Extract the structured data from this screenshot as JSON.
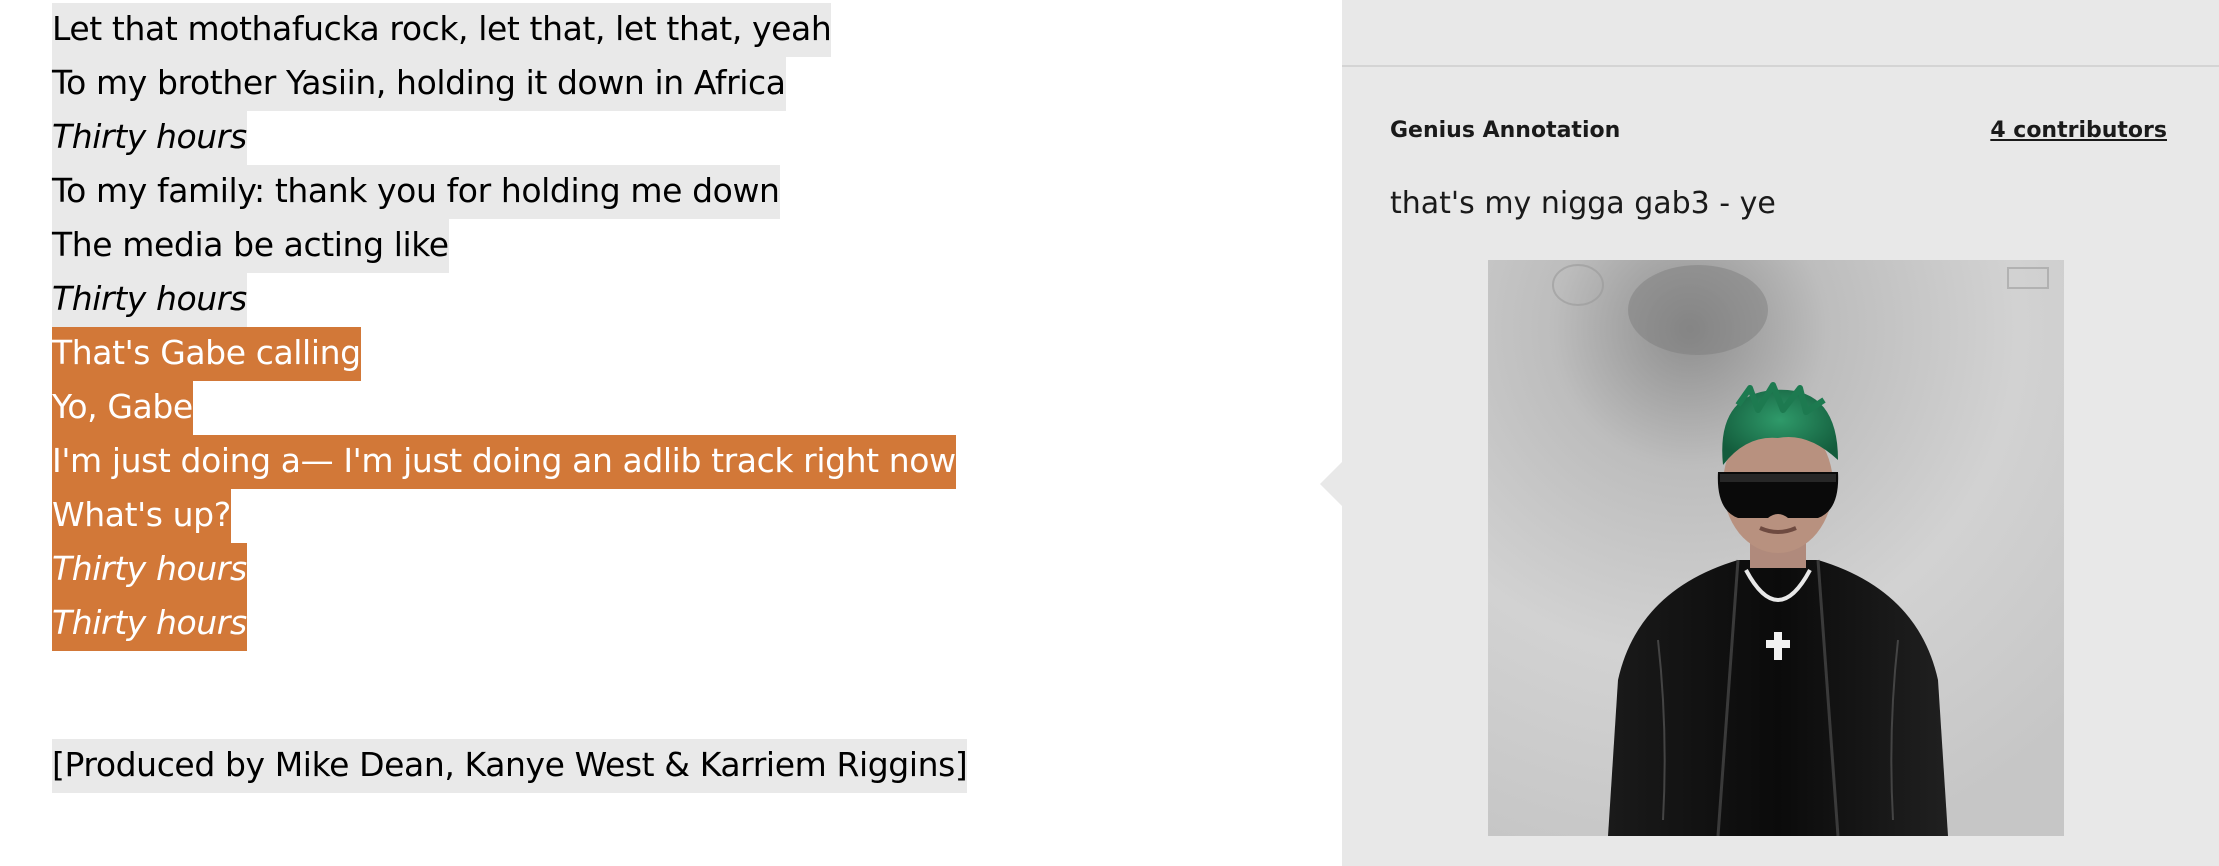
{
  "lyrics": {
    "lines": [
      {
        "text": "Let that mothafucka rock, let that, let that, yeah",
        "italic": false,
        "active": false
      },
      {
        "text": "To my brother Yasiin, holding it down in Africa",
        "italic": false,
        "active": false
      },
      {
        "text": "Thirty hours",
        "italic": true,
        "active": false
      },
      {
        "text": "To my family: thank you for holding me down",
        "italic": false,
        "active": false
      },
      {
        "text": "The media be acting like",
        "italic": false,
        "active": false
      },
      {
        "text": "Thirty hours",
        "italic": true,
        "active": false
      },
      {
        "text": "That's Gabe calling",
        "italic": false,
        "active": true
      },
      {
        "text": "Yo, Gabe",
        "italic": false,
        "active": true
      },
      {
        "text": "I'm just doing a— I'm just doing an adlib track right now",
        "italic": false,
        "active": true
      },
      {
        "text": "What's up?",
        "italic": false,
        "active": true
      },
      {
        "text": "Thirty hours",
        "italic": true,
        "active": true
      },
      {
        "text": "Thirty hours",
        "italic": true,
        "active": true
      }
    ],
    "credits": "[Produced by Mike Dean, Kanye West & Karriem Riggins]"
  },
  "annotation": {
    "label": "Genius Annotation",
    "contributors_link": "4 contributors",
    "body": "that's my nigga gab3 - ye",
    "image_icon": "photo-person-green-hair-sunglasses"
  },
  "colors": {
    "highlight_active": "#d27838",
    "highlight_inactive": "#e9e9e9",
    "panel_background": "#e8e8e8"
  }
}
